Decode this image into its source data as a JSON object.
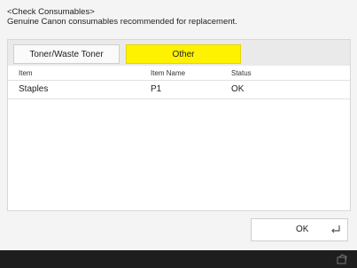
{
  "header": {
    "title": "<Check Consumables>",
    "subtitle": "Genuine Canon consumables recommended for replacement."
  },
  "tabs": [
    {
      "label": "Toner/Waste Toner",
      "selected": false
    },
    {
      "label": "Other",
      "selected": true
    }
  ],
  "table": {
    "columns": [
      "Item",
      "Item Name",
      "Status"
    ],
    "rows": [
      {
        "item": "Staples",
        "item_name": "P1",
        "status": "OK"
      }
    ]
  },
  "buttons": {
    "ok_label": "OK",
    "ok_icon": "enter-return-icon"
  },
  "footer": {
    "icon": "device-status-icon"
  },
  "colors": {
    "selected_tab": "#fff200",
    "footer_bar": "#1e1e1e"
  }
}
